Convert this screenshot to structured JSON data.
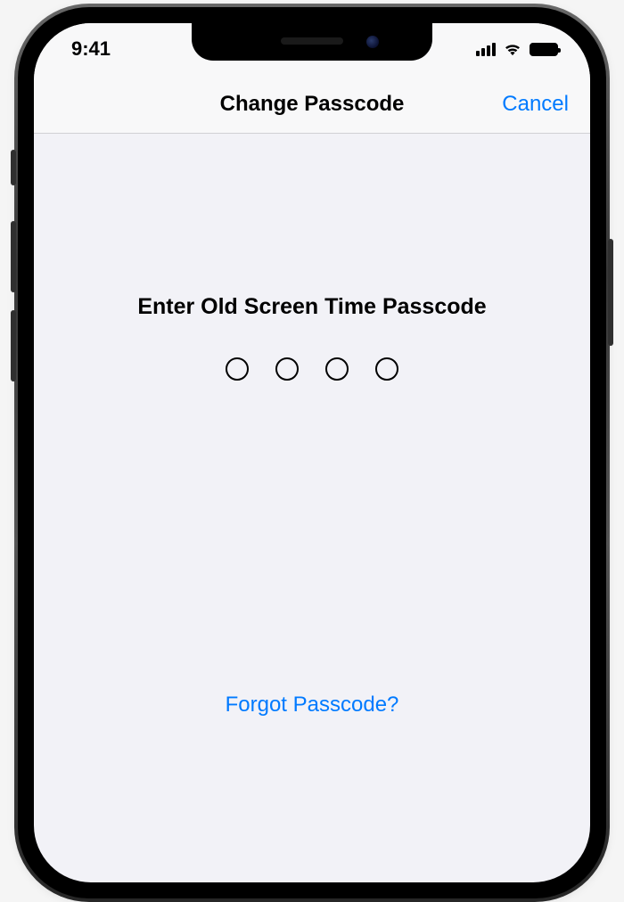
{
  "status": {
    "time": "9:41"
  },
  "nav": {
    "title": "Change Passcode",
    "cancel_label": "Cancel"
  },
  "content": {
    "prompt": "Enter Old Screen Time Passcode",
    "passcode_length": 4,
    "forgot_label": "Forgot Passcode?"
  },
  "colors": {
    "accent": "#007aff",
    "background": "#f2f2f7"
  }
}
